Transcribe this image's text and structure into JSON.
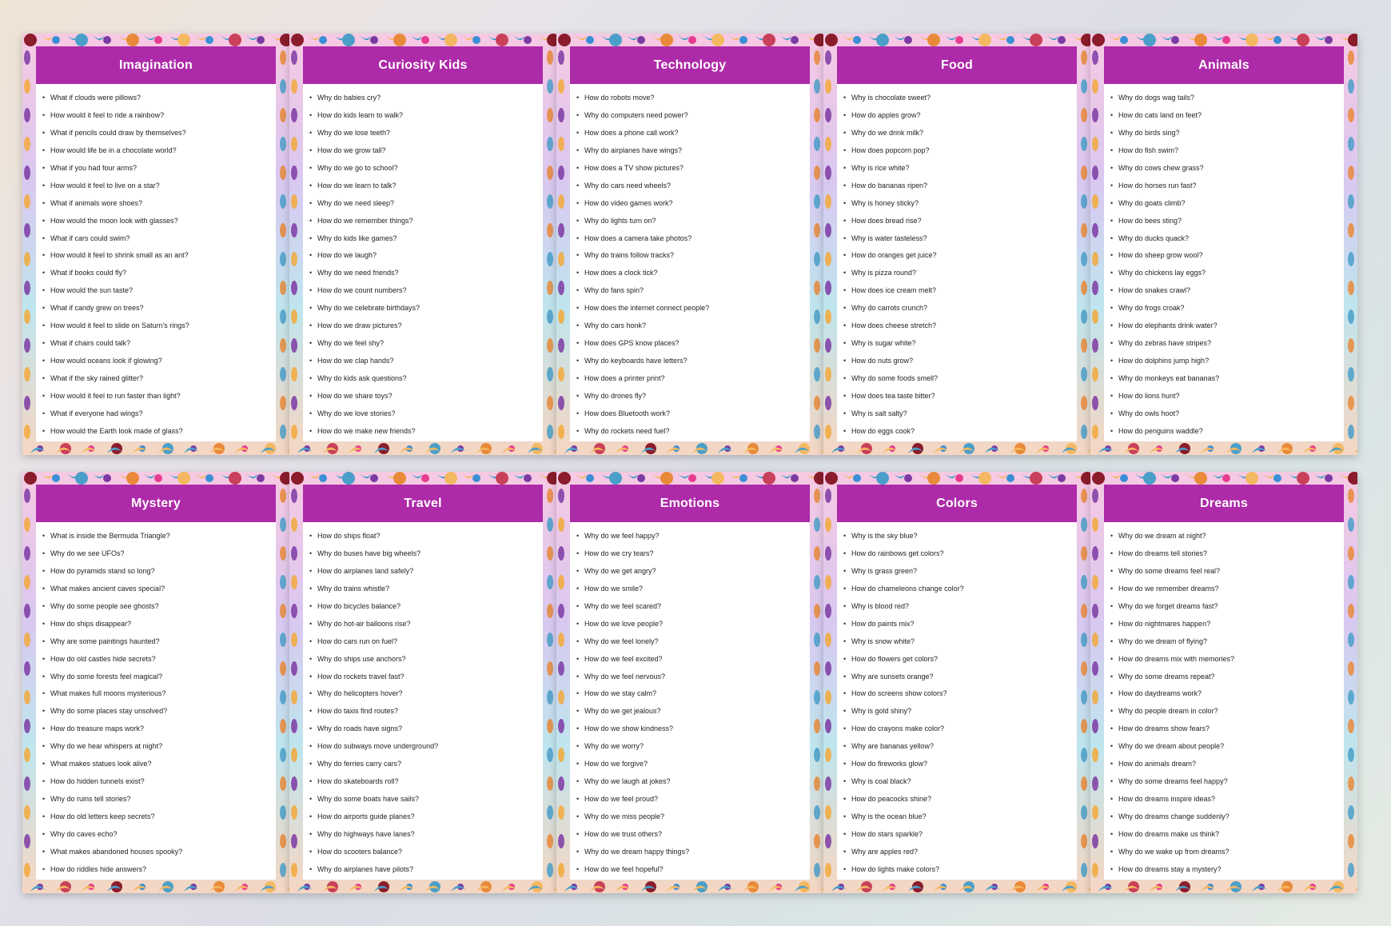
{
  "pages": [
    {
      "title": "Imagination",
      "questions": [
        "What if clouds were pillows?",
        "How would it feel to ride a rainbow?",
        "What if pencils could draw by themselves?",
        "How would life be in a chocolate world?",
        "What if you had four arms?",
        "How would it feel to live on a star?",
        "What if animals wore shoes?",
        "How would the moon look with glasses?",
        "What if cars could swim?",
        "How would it feel to shrink small as an ant?",
        "What if books could fly?",
        "How would the sun taste?",
        "What if candy grew on trees?",
        "How would it feel to slide on Saturn's rings?",
        "What if chairs could talk?",
        "How would oceans look if glowing?",
        "What if the sky rained glitter?",
        "How would it feel to run faster than light?",
        "What if everyone had wings?",
        "How would the Earth look made of glass?"
      ]
    },
    {
      "title": "Curiosity Kids",
      "questions": [
        "Why do babies cry?",
        "How do kids learn to walk?",
        "Why do we lose teeth?",
        "How do we grow tall?",
        "Why do we go to school?",
        "How do we learn to talk?",
        "Why do we need sleep?",
        "How do we remember things?",
        "Why do kids like games?",
        "How do we laugh?",
        "Why do we need friends?",
        "How do we count numbers?",
        "Why do we celebrate birthdays?",
        "How do we draw pictures?",
        "Why do we feel shy?",
        "How do we clap hands?",
        "Why do kids ask questions?",
        "How do we share toys?",
        "Why do we love stories?",
        "How do we make new friends?"
      ]
    },
    {
      "title": "Technology",
      "questions": [
        "How do robots move?",
        "Why do computers need power?",
        "How does a phone call work?",
        "Why do airplanes have wings?",
        "How does a TV show pictures?",
        "Why do cars need wheels?",
        "How do video games work?",
        "Why do lights turn on?",
        "How does a camera take photos?",
        "Why do trains follow tracks?",
        "How does a clock tick?",
        "Why do fans spin?",
        "How does the internet connect people?",
        "Why do cars honk?",
        "How does GPS know places?",
        "Why do keyboards have letters?",
        "How does a printer print?",
        "Why do drones fly?",
        "How does Bluetooth work?",
        "Why do rockets need fuel?"
      ]
    },
    {
      "title": "Food",
      "questions": [
        "Why is chocolate sweet?",
        "How do apples grow?",
        "Why do we drink milk?",
        "How does popcorn pop?",
        "Why is rice white?",
        "How do bananas ripen?",
        "Why is honey sticky?",
        "How does bread rise?",
        "Why is water tasteless?",
        "How do oranges get juice?",
        "Why is pizza round?",
        "How does ice cream melt?",
        "Why do carrots crunch?",
        "How does cheese stretch?",
        "Why is sugar white?",
        "How do nuts grow?",
        "Why do some foods smell?",
        "How does tea taste bitter?",
        "Why is salt salty?",
        "How do eggs cook?"
      ]
    },
    {
      "title": "Animals",
      "questions": [
        "Why do dogs wag tails?",
        "How do cats land on feet?",
        "Why do birds sing?",
        "How do fish swim?",
        "Why do cows chew grass?",
        "How do horses run fast?",
        "Why do goats climb?",
        "How do bees sting?",
        "Why do ducks quack?",
        "How do sheep grow wool?",
        "Why do chickens lay eggs?",
        "How do snakes crawl?",
        "Why do frogs croak?",
        "How do elephants drink water?",
        "Why do zebras have stripes?",
        "How do dolphins jump high?",
        "Why do monkeys eat bananas?",
        "How do lions hunt?",
        "Why do owls hoot?",
        "How do penguins waddle?"
      ]
    },
    {
      "title": "Mystery",
      "questions": [
        "What is inside the Bermuda Triangle?",
        "Why do we see UFOs?",
        "How do pyramids stand so long?",
        "What makes ancient caves special?",
        "Why do some people see ghosts?",
        "How do ships disappear?",
        "Why are some paintings haunted?",
        "How do old castles hide secrets?",
        "Why do some forests feel magical?",
        "What makes full moons mysterious?",
        "Why do some places stay unsolved?",
        "How do treasure maps work?",
        "Why do we hear whispers at night?",
        "What makes statues look alive?",
        "How do hidden tunnels exist?",
        "Why do ruins tell stories?",
        "How do old letters keep secrets?",
        "Why do caves echo?",
        "What makes abandoned houses spooky?",
        "How do riddles hide answers?"
      ]
    },
    {
      "title": "Travel",
      "questions": [
        "How do ships float?",
        "Why do buses have big wheels?",
        "How do airplanes land safely?",
        "Why do trains whistle?",
        "How do bicycles balance?",
        "Why do hot-air balloons rise?",
        "How do cars run on fuel?",
        "Why do ships use anchors?",
        "How do rockets travel fast?",
        "Why do helicopters hover?",
        "How do taxis find routes?",
        "Why do roads have signs?",
        "How do subways move underground?",
        "Why do ferries carry cars?",
        "How do skateboards roll?",
        "Why do some boats have sails?",
        "How do airports guide planes?",
        "Why do highways have lanes?",
        "How do scooters balance?",
        "Why do airplanes have pilots?"
      ]
    },
    {
      "title": "Emotions",
      "questions": [
        "Why do we feel happy?",
        "How do we cry tears?",
        "Why do we get angry?",
        "How do we smile?",
        "Why do we feel scared?",
        "How do we love people?",
        "Why do we feel lonely?",
        "How do we feel excited?",
        "Why do we feel nervous?",
        "How do we stay calm?",
        "Why do we get jealous?",
        "How do we show kindness?",
        "Why do we worry?",
        "How do we forgive?",
        "Why do we laugh at jokes?",
        "How do we feel proud?",
        "Why do we miss people?",
        "How do we trust others?",
        "Why do we dream happy things?",
        "How do we feel hopeful?"
      ]
    },
    {
      "title": "Colors",
      "questions": [
        "Why is the sky blue?",
        "How do rainbows get colors?",
        "Why is grass green?",
        "How do chameleons change color?",
        "Why is blood red?",
        "How do paints mix?",
        "Why is snow white?",
        "How do flowers get colors?",
        "Why are sunsets orange?",
        "How do screens show colors?",
        "Why is gold shiny?",
        "How do crayons make color?",
        "Why are bananas yellow?",
        "How do fireworks glow?",
        "Why is coal black?",
        "How do peacocks shine?",
        "Why is the ocean blue?",
        "How do stars sparkle?",
        "Why are apples red?",
        "How do lights make colors?"
      ]
    },
    {
      "title": "Dreams",
      "questions": [
        "Why do we dream at night?",
        "How do dreams tell stories?",
        "Why do some dreams feel real?",
        "How do we remember dreams?",
        "Why do we forget dreams fast?",
        "How do nightmares happen?",
        "Why do we dream of flying?",
        "How do dreams mix with memories?",
        "Why do some dreams repeat?",
        "How do daydreams work?",
        "Why do people dream in color?",
        "How do dreams show fears?",
        "Why do we dream about people?",
        "How do animals dream?",
        "Why do some dreams feel happy?",
        "How do dreams inspire ideas?",
        "Why do dreams change suddenly?",
        "How do dreams make us think?",
        "Why do we wake up from dreams?",
        "How do dreams stay a mystery?"
      ]
    }
  ]
}
